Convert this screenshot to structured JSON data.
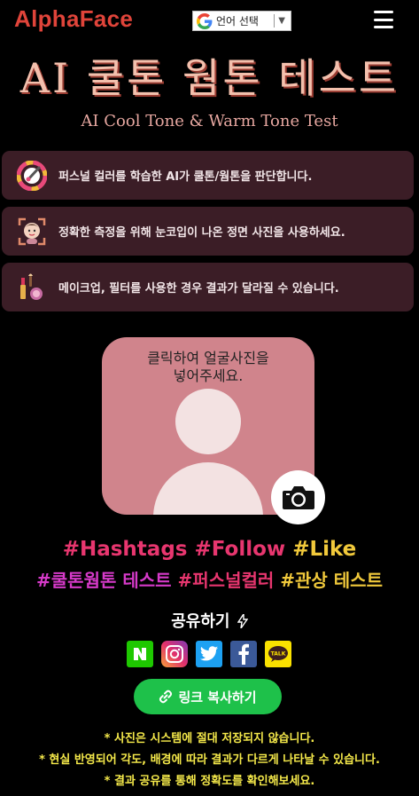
{
  "header": {
    "logo": "AlphaFace",
    "language_label": "언어 선택",
    "language_arrow": "▼"
  },
  "hero": {
    "title": "AI 쿨톤 웜톤 테스트",
    "subtitle": "AI Cool Tone & Warm Tone Test"
  },
  "info_items": [
    {
      "icon": "color-wheel-icon",
      "text": "퍼스널 컬러를 학습한 AI가 쿨톤/웜톤을 판단합니다."
    },
    {
      "icon": "face-scan-icon",
      "text": "정확한 측정을 위해 눈코입이 나온 정면 사진을 사용하세요."
    },
    {
      "icon": "makeup-icon",
      "text": "메이크업, 필터를 사용한 경우 결과가 달라질 수 있습니다."
    }
  ],
  "upload": {
    "caption_line1": "클릭하여 얼굴사진을",
    "caption_line2": "넣어주세요."
  },
  "hashtags": {
    "line1": [
      {
        "text": "#Hashtags",
        "color": "#e8366f"
      },
      {
        "text": "#Follow",
        "color": "#e8366f"
      },
      {
        "text": "#Like",
        "color": "#f1c93b"
      }
    ],
    "line2": [
      {
        "text": "#쿨톤웜톤 테스트",
        "color": "#d63ac9"
      },
      {
        "text": "#퍼스널컬러",
        "color": "#e8366f"
      },
      {
        "text": "#관상 테스트",
        "color": "#f1c93b"
      }
    ]
  },
  "share": {
    "label": "공유하기",
    "services": [
      "naver-icon",
      "instagram-icon",
      "twitter-icon",
      "facebook-icon",
      "kakaotalk-icon"
    ],
    "copy_label": "링크 복사하기"
  },
  "notes": [
    "* 사진은 시스템에 절대 저장되지 않습니다.",
    "* 현실 반영되어 각도, 배경에 따라 결과가 다르게 나타날 수 있습니다.",
    "* 결과 공유를 통해 정확도를 확인해보세요."
  ],
  "colors": {
    "accent": "#e0443a",
    "title": "#f3c0ad",
    "info_bg": "#3b1d26",
    "upload_bg": "#d0848c",
    "copy_button": "#1ec14a",
    "notes": "#f5e94a"
  }
}
